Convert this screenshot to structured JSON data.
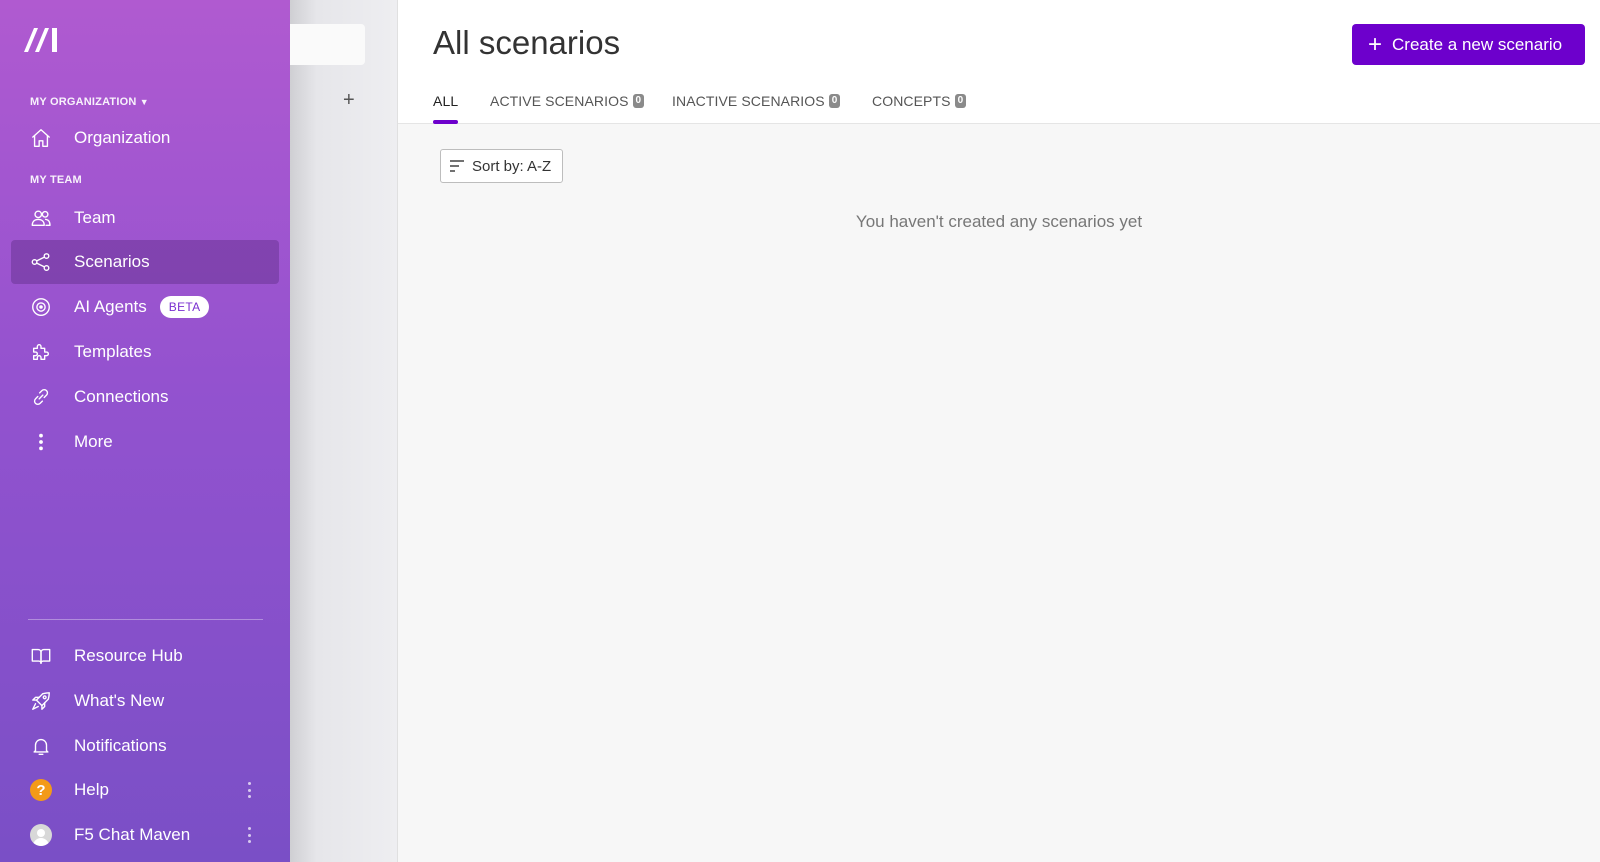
{
  "sidebar": {
    "org_label": "MY ORGANIZATION",
    "team_label": "MY TEAM",
    "items": {
      "organization": "Organization",
      "team": "Team",
      "scenarios": "Scenarios",
      "ai_agents": "AI Agents",
      "ai_agents_badge": "BETA",
      "templates": "Templates",
      "connections": "Connections",
      "more": "More"
    },
    "bottom": {
      "resource_hub": "Resource Hub",
      "whats_new": "What's New",
      "notifications": "Notifications",
      "help": "Help",
      "help_icon": "?",
      "user": "F5 Chat Maven"
    },
    "icons": [
      "logo-icon",
      "home-icon",
      "users-icon",
      "share-icon",
      "ai-agent-icon",
      "puzzle-icon",
      "link-icon",
      "more-vertical-icon",
      "book-icon",
      "rocket-icon",
      "bell-icon",
      "help-icon",
      "avatar"
    ]
  },
  "secondary": {
    "add_icon": "+"
  },
  "main": {
    "title": "All scenarios",
    "create_button": "Create a new scenario",
    "create_icon": "+",
    "tabs": [
      {
        "label": "ALL"
      },
      {
        "label": "ACTIVE SCENARIOS",
        "count": "0"
      },
      {
        "label": "INACTIVE SCENARIOS",
        "count": "0"
      },
      {
        "label": "CONCEPTS",
        "count": "0"
      }
    ],
    "sort_label": "Sort by: A-Z",
    "empty_message": "You haven't created any scenarios yet"
  },
  "colors": {
    "accent": "#6d00cc",
    "sidebar_top": "#b05ad0",
    "sidebar_bottom": "#7a4fc6"
  }
}
